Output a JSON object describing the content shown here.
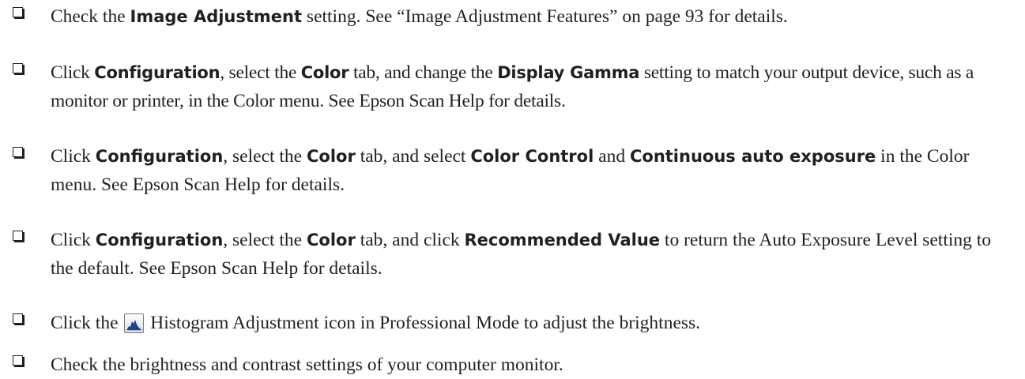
{
  "items": [
    {
      "p1": "Check the ",
      "b1": "Image Adjustment",
      "p2": " setting. See “Image Adjustment Features” on page 93 for details."
    },
    {
      "p1": "Click ",
      "b1": "Configuration",
      "p2": ", select the ",
      "b2": "Color",
      "p3": " tab, and change the ",
      "b3": "Display Gamma",
      "p4": " setting to match your output device, such as a monitor or printer, in the Color menu. See Epson Scan Help for details."
    },
    {
      "p1": "Click ",
      "b1": "Configuration",
      "p2": ", select the ",
      "b2": "Color",
      "p3": " tab, and select ",
      "b3": "Color Control",
      "p4": " and ",
      "b4": "Continuous auto exposure",
      "p5": " in the Color menu. See Epson Scan Help for details."
    },
    {
      "p1": "Click ",
      "b1": "Configuration",
      "p2": ", select the ",
      "b2": "Color",
      "p3": " tab, and click ",
      "b3": "Recommended Value",
      "p4": " to return the Auto Exposure Level setting to the default. See Epson Scan Help for details."
    },
    {
      "p1": "Click the ",
      "icon": "histogram-adjustment-icon",
      "p2": " Histogram Adjustment icon in Professional Mode to adjust the brightness."
    },
    {
      "p1": "Check the brightness and contrast settings of your computer monitor."
    }
  ]
}
